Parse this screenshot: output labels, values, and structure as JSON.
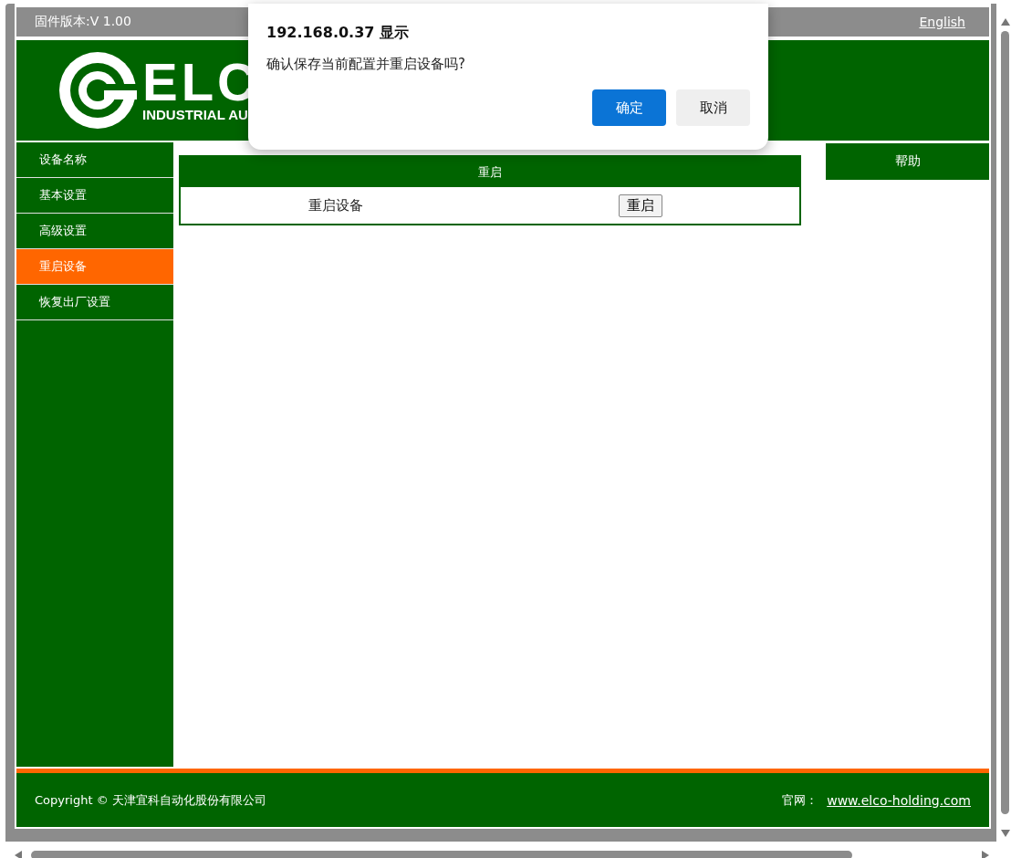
{
  "top_bar": {
    "firmware": "固件版本:V 1.00",
    "language_link": "English"
  },
  "logo": {
    "wordmark": "ELC",
    "tagline": "INDUSTRIAL AU"
  },
  "sidebar": {
    "items": [
      {
        "label": "设备名称",
        "selected": false
      },
      {
        "label": "基本设置",
        "selected": false
      },
      {
        "label": "高级设置",
        "selected": false
      },
      {
        "label": "重启设备",
        "selected": true
      },
      {
        "label": "恢复出厂设置",
        "selected": false
      }
    ]
  },
  "panel": {
    "title": "重启",
    "rows": [
      {
        "label": "重启设备",
        "button": "重启"
      }
    ]
  },
  "help": {
    "title": "帮助"
  },
  "footer": {
    "copyright": "Copyright © 天津宜科自动化股份有限公司",
    "site_label": "官网：",
    "site_link": "www.elco-holding.com"
  },
  "dialog": {
    "title": "192.168.0.37 显示",
    "message": "确认保存当前配置并重启设备吗?",
    "buttons": [
      {
        "label": "确定",
        "kind": "primary"
      },
      {
        "label": "取消",
        "kind": "secondary"
      }
    ]
  }
}
